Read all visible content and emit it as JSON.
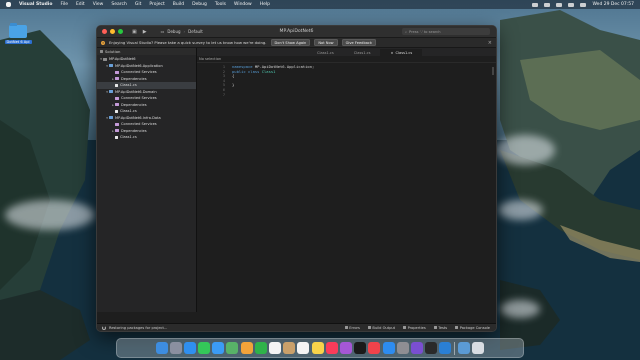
{
  "menubar": {
    "app": "Visual Studio",
    "items": [
      "File",
      "Edit",
      "View",
      "Search",
      "Git",
      "Project",
      "Build",
      "Debug",
      "Tools",
      "Window",
      "Help"
    ],
    "clock": "Wed 29 Dec 07:57"
  },
  "desktop": {
    "icon_label": "DotNet 6 Api"
  },
  "window": {
    "title": "MP.ApiDotNet6",
    "config": "Debug",
    "platform": "Default",
    "search_placeholder": "Press '.' to search"
  },
  "infobar": {
    "message": "Enjoying Visual Studio? Please take a quick survey to let us know how we're doing.",
    "buttons": [
      "Don't Show Again",
      "Not Now",
      "Give Feedback"
    ]
  },
  "solution": {
    "header": "Solution",
    "tree": [
      {
        "label": "MP.ApiDotNet6",
        "level": 0,
        "icon": "sln",
        "arrow": "▾"
      },
      {
        "label": "MP.ApiDotNet6.Application",
        "level": 1,
        "icon": "proj",
        "arrow": "▾"
      },
      {
        "label": "Connected Services",
        "level": 2,
        "icon": "fold",
        "arrow": ""
      },
      {
        "label": "Dependencies",
        "level": 2,
        "icon": "fold",
        "arrow": "▸"
      },
      {
        "label": "Class1.cs",
        "level": 2,
        "icon": "file",
        "arrow": "",
        "selected": true
      },
      {
        "label": "MP.ApiDotNet6.Domain",
        "level": 1,
        "icon": "proj",
        "arrow": "▾"
      },
      {
        "label": "Connected Services",
        "level": 2,
        "icon": "fold",
        "arrow": ""
      },
      {
        "label": "Dependencies",
        "level": 2,
        "icon": "fold",
        "arrow": "▸"
      },
      {
        "label": "Class1.cs",
        "level": 2,
        "icon": "file",
        "arrow": ""
      },
      {
        "label": "MP.ApiDotNet6.Infra.Data",
        "level": 1,
        "icon": "proj",
        "arrow": "▾"
      },
      {
        "label": "Connected Services",
        "level": 2,
        "icon": "fold",
        "arrow": ""
      },
      {
        "label": "Dependencies",
        "level": 2,
        "icon": "fold",
        "arrow": "▸"
      },
      {
        "label": "Class1.cs",
        "level": 2,
        "icon": "file",
        "arrow": ""
      }
    ]
  },
  "editor": {
    "tabs": [
      {
        "label": "Class1.cs",
        "active": false
      },
      {
        "label": "Class1.cs",
        "active": false
      },
      {
        "label": "Class1.cs",
        "active": true
      }
    ],
    "breadcrumb": "No selection",
    "line_numbers": [
      "1",
      "2",
      "3",
      "4",
      "5",
      "6",
      "7"
    ],
    "code": [
      {
        "kw": "namespace ",
        "ty": "",
        "rest": "MP.ApiDotNet6.Application;"
      },
      {
        "kw": "public class ",
        "ty": "Class1",
        "rest": ""
      },
      {
        "kw": "",
        "ty": "",
        "rest": "{"
      },
      {
        "kw": "",
        "ty": "",
        "rest": ""
      },
      {
        "kw": "",
        "ty": "",
        "rest": "}"
      },
      {
        "kw": "",
        "ty": "",
        "rest": ""
      },
      {
        "kw": "",
        "ty": "",
        "rest": ""
      }
    ]
  },
  "statusbar": {
    "message": "Restoring packages for project...",
    "panels": [
      "Errors",
      "Build Output",
      "Properties",
      "Tests",
      "Package Console"
    ]
  },
  "dock": {
    "apps": [
      "finder",
      "launchpad",
      "safari",
      "messages",
      "mail",
      "maps",
      "photos",
      "facetime",
      "calendar",
      "contacts",
      "reminders",
      "notes",
      "music",
      "podcasts",
      "tv",
      "news",
      "app-store",
      "system-preferences",
      "visual-studio-mac",
      "terminal",
      "visual-studio-code"
    ],
    "colors": [
      "#3d8de0",
      "#8a8fa0",
      "#2f8ff0",
      "#34c759",
      "#3b9bf5",
      "#58b368",
      "#f2a33a",
      "#2fb34a",
      "#f4f4f4",
      "#c9a06a",
      "#f4f4f4",
      "#f7d34a",
      "#fa3c5a",
      "#a557d6",
      "#1a1a1a",
      "#f0434b",
      "#2d8cf0",
      "#8e8e93",
      "#7a4fd0",
      "#2a2a2a",
      "#2a7fd4"
    ],
    "trash": [
      "downloads-stack",
      "trash"
    ]
  },
  "colors": {
    "accent": "#2c6fd1",
    "editor_bg": "#1e1e1e",
    "sidebar_bg": "#252526"
  }
}
